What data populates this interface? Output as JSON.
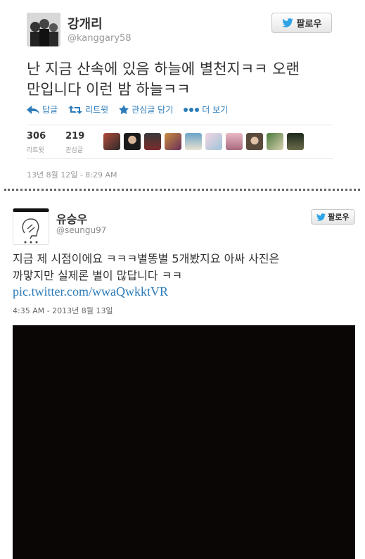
{
  "tweet1": {
    "display_name": "강개리",
    "handle": "@kanggary58",
    "follow_label": "팔로우",
    "text_line1": "난 지금 산속에 있음 하늘에 별천지ㅋㅋ 오랜",
    "text_line2": "만입니다 이런 밤 하늘ㅋㅋ",
    "actions": {
      "reply": "답글",
      "retweet": "리트윗",
      "favorite": "관심글 담기",
      "more": "더 보기"
    },
    "stats": {
      "retweets_count": "306",
      "retweets_label": "리트윗",
      "favorites_count": "219",
      "favorites_label": "관심글"
    },
    "timestamp": "13년 8월 12일 - 8:29 AM"
  },
  "tweet2": {
    "display_name": "유승우",
    "handle": "@seungu97",
    "follow_label": "팔로우",
    "text_line1": "지금 제 시점이에요 ㅋㅋㅋ별똥별 5개봤지요 아싸 사진은",
    "text_line2": "까맣지만 실제론 별이 많답니다 ㅋㅋ",
    "link": "pic.twitter.com/wwaQwkktVR",
    "timestamp": "4:35 AM - 2013년 8월 13일"
  },
  "colors": {
    "link": "#2b7bb9",
    "bird": "#2ea3e6",
    "muted": "#999999",
    "photo": "#0a0606"
  }
}
